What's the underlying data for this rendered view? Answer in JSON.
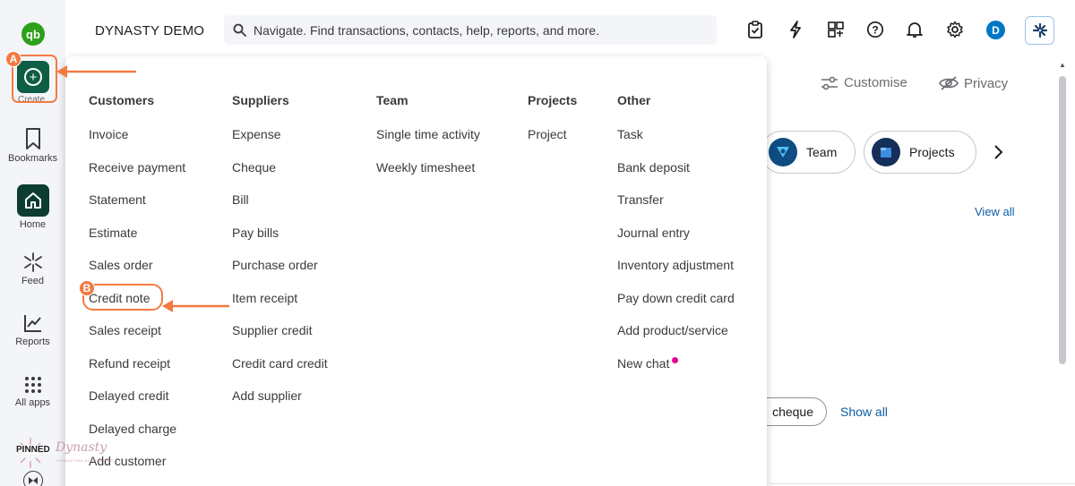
{
  "company": "DYNASTY DEMO",
  "search": {
    "placeholder": "Navigate. Find transactions, contacts, help, reports, and more."
  },
  "avatar_letter": "D",
  "rail": {
    "logo": "qb",
    "create_label": "Create",
    "items": [
      {
        "label": "Bookmarks",
        "icon": "bookmark-icon"
      },
      {
        "label": "Home",
        "icon": "home-icon"
      },
      {
        "label": "Feed",
        "icon": "sparkle-icon"
      },
      {
        "label": "Reports",
        "icon": "chart-icon"
      },
      {
        "label": "All apps",
        "icon": "grid-icon"
      }
    ],
    "pinned": "PINNED"
  },
  "annotations": {
    "a": "A",
    "b": "B"
  },
  "background": {
    "customise": "Customise",
    "privacy": "Privacy",
    "pill_team": "Team",
    "pill_projects": "Projects",
    "view_all": "View all",
    "cheque_btn": "cheque",
    "show_all": "Show all"
  },
  "menu": {
    "customers": {
      "heading": "Customers",
      "items": [
        "Invoice",
        "Receive payment",
        "Statement",
        "Estimate",
        "Sales order",
        "Credit note",
        "Sales receipt",
        "Refund receipt",
        "Delayed credit",
        "Delayed charge",
        "Add customer"
      ]
    },
    "suppliers": {
      "heading": "Suppliers",
      "items": [
        "Expense",
        "Cheque",
        "Bill",
        "Pay bills",
        "Purchase order",
        "Item receipt",
        "Supplier credit",
        "Credit card credit",
        "Add supplier"
      ]
    },
    "team": {
      "heading": "Team",
      "items": [
        "Single time activity",
        "Weekly timesheet"
      ]
    },
    "projects": {
      "heading": "Projects",
      "items": [
        "Project"
      ]
    },
    "other": {
      "heading": "Other",
      "items": [
        "Task",
        "Bank deposit",
        "Transfer",
        "Journal entry",
        "Inventory adjustment",
        "Pay down credit card",
        "Add product/service",
        "New chat"
      ]
    }
  },
  "watermark": {
    "brand": "Dynasty",
    "sub": "CONSULTING ACCOUNTING"
  },
  "colors": {
    "accent": "#f47a42",
    "brand_green": "#2ca01c",
    "create_bg": "#0d5e45",
    "link": "#0d5fa5"
  }
}
